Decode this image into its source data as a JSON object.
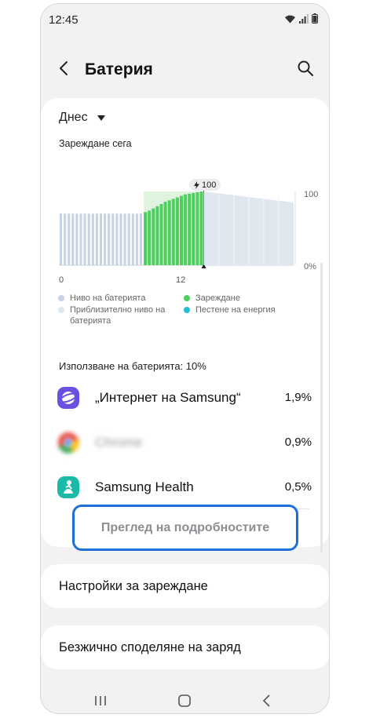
{
  "status": {
    "time": "12:45"
  },
  "header": {
    "title": "Батерия"
  },
  "period": {
    "selected": "Днес"
  },
  "chart_section": {
    "label": "Зареждане сега"
  },
  "chart_data": {
    "type": "bar",
    "charging_badge": "100",
    "x_tick_labels": [
      "0",
      "12"
    ],
    "y_tick_labels": [
      "100",
      "0%"
    ],
    "ylim": [
      0,
      100
    ],
    "series": [
      {
        "name": "Ниво на батерията",
        "values": [
          70,
          70,
          70,
          70,
          70,
          70,
          70,
          70,
          70,
          70,
          70,
          70,
          70,
          70,
          70,
          70,
          70,
          70,
          70,
          70,
          70
        ]
      },
      {
        "name": "Зареждане",
        "values": [
          72,
          74,
          77,
          80,
          83,
          86,
          88,
          90,
          92,
          94,
          96,
          97,
          98,
          99,
          100
        ]
      },
      {
        "name": "Приблизително ниво на батерията",
        "values": [
          100,
          99,
          98,
          97,
          96,
          95,
          94,
          93,
          92,
          91,
          90,
          89,
          88,
          87,
          86,
          85
        ]
      }
    ],
    "colors": {
      "battery": "#c5d3e4",
      "charging": "#4fcf5f",
      "charging_bg": "#dff3df",
      "estimate": "#e1e7ef",
      "power_saving": "#1fc0d6"
    }
  },
  "legend": {
    "items": [
      {
        "label": "Ниво на батерията",
        "color": "#c5d3e4"
      },
      {
        "label": "Зареждане",
        "color": "#4fcf5f"
      },
      {
        "label": "Приблизително ниво на батерията",
        "color": "#dde6ef"
      },
      {
        "label": "Пестене на енергия",
        "color": "#1fc0d6"
      }
    ]
  },
  "usage": {
    "label": "Използване на батерията: 10%",
    "apps": [
      {
        "name": "„Интернет на Samsung“",
        "percent": "1,9%",
        "icon": "samsung-internet-icon"
      },
      {
        "name": "Chrome",
        "percent": "0,9%",
        "icon": "chrome-icon"
      },
      {
        "name": "Samsung Health",
        "percent": "0,5%",
        "icon": "samsung-health-icon"
      }
    ],
    "details_button": "Преглед на подробностите"
  },
  "settings": {
    "charging_settings": "Настройки за зареждане",
    "wireless_share": "Безжично споделяне на заряд"
  }
}
